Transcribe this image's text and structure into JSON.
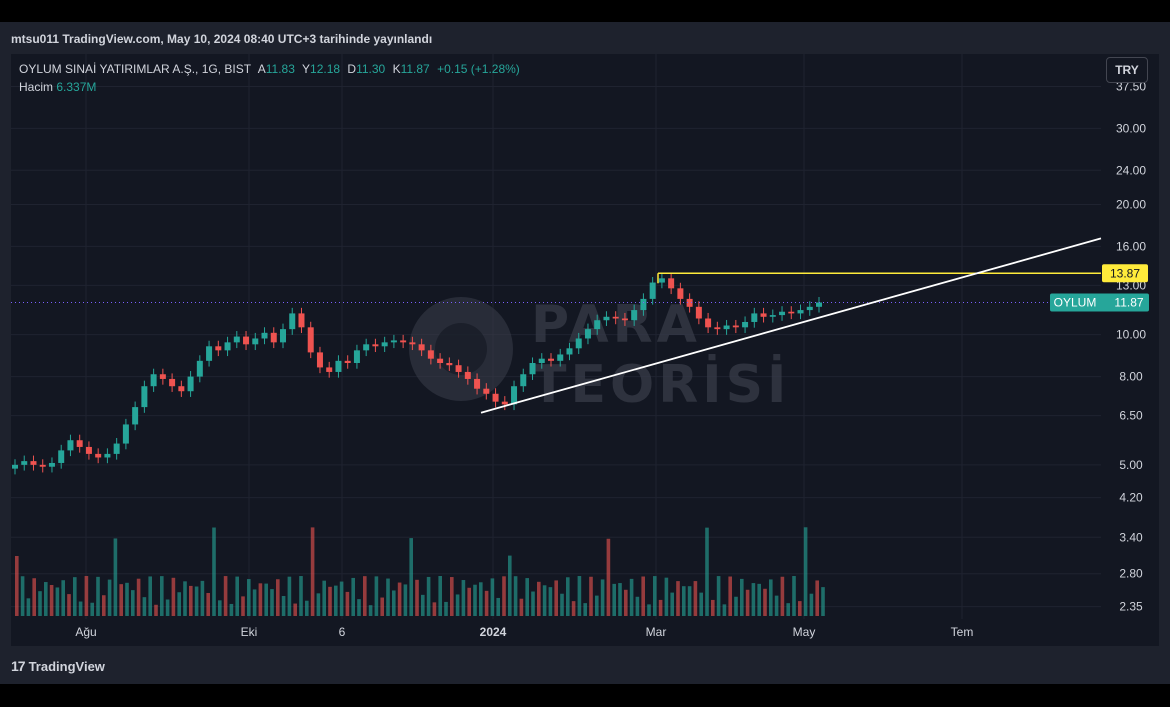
{
  "header": {
    "published_line": "mtsu011 TradingView.com, May 10, 2024 08:40 UTC+3 tarihinde yayınlandı"
  },
  "legend": {
    "symbol_line": "OYLUM SINAİ YATIRIMLAR A.Ş., 1G, BIST",
    "o_label": "A",
    "o_value": "11.83",
    "h_label": "Y",
    "h_value": "12.18",
    "l_label": "D",
    "l_value": "11.30",
    "c_label": "K",
    "c_value": "11.87",
    "change": "+0.15 (+1.28%)",
    "volume_label": "Hacim",
    "volume_value": "6.337M"
  },
  "currency_button": "TRY",
  "watermark": {
    "line1": "PARA",
    "line2": "TEORİSİ"
  },
  "footer": {
    "brand": "TradingView"
  },
  "colors": {
    "up": "#26a69a",
    "down": "#ef5350",
    "trendline": "#ffffff",
    "resistance": "#ffeb3b",
    "price_label_bg": "#26a69a",
    "resistance_label_bg": "#ffeb3b",
    "panel_bg": "#131722",
    "grid": "#1f2330"
  },
  "chart_data": {
    "type": "candlestick",
    "scale": "log",
    "y_ticks": [
      "37.50",
      "30.00",
      "24.00",
      "20.00",
      "16.00",
      "13.00",
      "10.00",
      "8.00",
      "6.50",
      "5.00",
      "4.20",
      "3.40",
      "2.80",
      "2.35"
    ],
    "x_ticks": [
      "Ağu",
      "Eki",
      "6",
      "2024",
      "Mar",
      "May",
      "Tem"
    ],
    "ylim": [
      2.2,
      38
    ],
    "last_price": {
      "symbol": "OYLUM",
      "value": "11.87"
    },
    "resistance": {
      "value": "13.87",
      "from_date": "2024-03-01"
    },
    "trendline": {
      "from": [
        "2023-12-27",
        6.6
      ],
      "to": [
        "2024-07-15",
        16.7
      ]
    },
    "closes": [
      5.0,
      5.1,
      5.0,
      4.95,
      5.05,
      5.4,
      5.7,
      5.5,
      5.3,
      5.2,
      5.3,
      5.6,
      6.2,
      6.8,
      7.6,
      8.1,
      7.9,
      7.6,
      7.4,
      8.0,
      8.7,
      9.4,
      9.2,
      9.6,
      9.9,
      9.5,
      9.8,
      10.1,
      9.6,
      10.3,
      11.2,
      10.4,
      9.1,
      8.4,
      8.2,
      8.7,
      8.6,
      9.2,
      9.5,
      9.4,
      9.6,
      9.7,
      9.6,
      9.5,
      9.2,
      8.8,
      8.6,
      8.5,
      8.2,
      7.9,
      7.5,
      7.3,
      7.0,
      6.9,
      7.6,
      8.1,
      8.6,
      8.8,
      8.7,
      9.0,
      9.3,
      9.8,
      10.3,
      10.8,
      11.0,
      10.9,
      10.8,
      11.4,
      12.1,
      13.2,
      13.5,
      12.8,
      12.1,
      11.6,
      10.9,
      10.4,
      10.3,
      10.5,
      10.4,
      10.7,
      11.2,
      11.0,
      11.1,
      11.3,
      11.2,
      11.4,
      11.6,
      11.87
    ],
    "volume_note": "volume bars shown at bottom, relative scale"
  }
}
